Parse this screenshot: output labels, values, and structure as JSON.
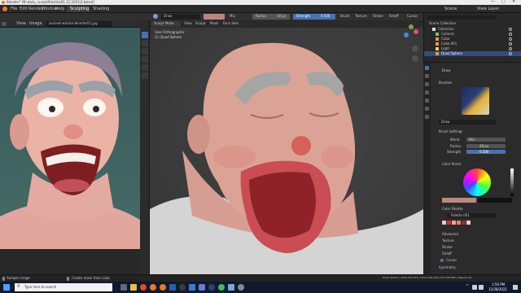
{
  "window": {
    "title": "Blender* [N:\\daily_sculpt\\files\\ha\\01.12.2021\\2.blend]"
  },
  "menubar": {
    "items": [
      "File",
      "Edit",
      "Render",
      "Window",
      "Help"
    ],
    "workspace_tabs": [
      "Sculpting",
      "Shading"
    ],
    "scene_label": "Scene",
    "view_layer_label": "View Layer"
  },
  "image_editor": {
    "menu": [
      "View",
      "Image"
    ],
    "image_name": "ancient-warrior-blender01.jpg",
    "status_left": "Sample image",
    "status_mid": "Create mask from color"
  },
  "viewport_header": {
    "mode": "Sculpt Mode",
    "menu": [
      "View",
      "Sculpt",
      "Mask",
      "Face Sets"
    ],
    "brush_name": "Draw",
    "radius_label": "Radius",
    "radius_value": "48 px",
    "strength_label": "Strength",
    "strength_value": "0.500",
    "brush_menu": "Brush",
    "texture_menu": "Texture",
    "stroke_menu": "Stroke",
    "falloff_menu": "Falloff",
    "cursor_menu": "Cursor"
  },
  "viewport_overlay": {
    "line1": "User Orthographic",
    "line2": "(1) Quad Sphere"
  },
  "outliner": {
    "title": "Scene Collection",
    "items": [
      {
        "label": "Collection",
        "icon": "collection-icon",
        "selected": false
      },
      {
        "label": "Camera",
        "icon": "camera-icon",
        "selected": false
      },
      {
        "label": "Cube",
        "icon": "mesh-icon",
        "selected": false
      },
      {
        "label": "Cube.001",
        "icon": "mesh-icon",
        "selected": false
      },
      {
        "label": "Light",
        "icon": "light-icon",
        "selected": false
      },
      {
        "label": "Quad Sphere",
        "icon": "mesh-icon",
        "selected": true
      }
    ]
  },
  "properties": {
    "tool_label": "Draw",
    "brushes_header": "Brushes",
    "brush_field": "Draw",
    "brush_settings_header": "Brush Settings",
    "blend_label": "Blend",
    "blend_value": "Mix",
    "radius_label": "Radius",
    "radius_value": "48 px",
    "strength_label": "Strength",
    "strength_value": "0.500",
    "color_picker_header": "Color Picker",
    "color_palette_header": "Color Palette",
    "palette_name": "Palette.001",
    "palette_colors": [
      "#f3c7b6",
      "#c0392b",
      "#e9a293",
      "#d9847a",
      "#9a2b2b",
      "#e8d0c6"
    ],
    "advanced": "Advanced",
    "texture": "Texture",
    "stroke": "Stroke",
    "falloff": "Falloff",
    "cursor": "Cursor",
    "symmetry": "Symmetry"
  },
  "statusbar": {
    "right": "Quad Sphere | Verts 223,418 | Faces 222,418 | Tris 444,836 | Objects 1/4"
  },
  "taskbar": {
    "search_placeholder": "Type here to search",
    "time": "1:56 PM",
    "date": "12/28/2021"
  },
  "colors": {
    "accent": "#4772b3",
    "skin": "#d9a394",
    "hair": "#9b9b9b"
  }
}
